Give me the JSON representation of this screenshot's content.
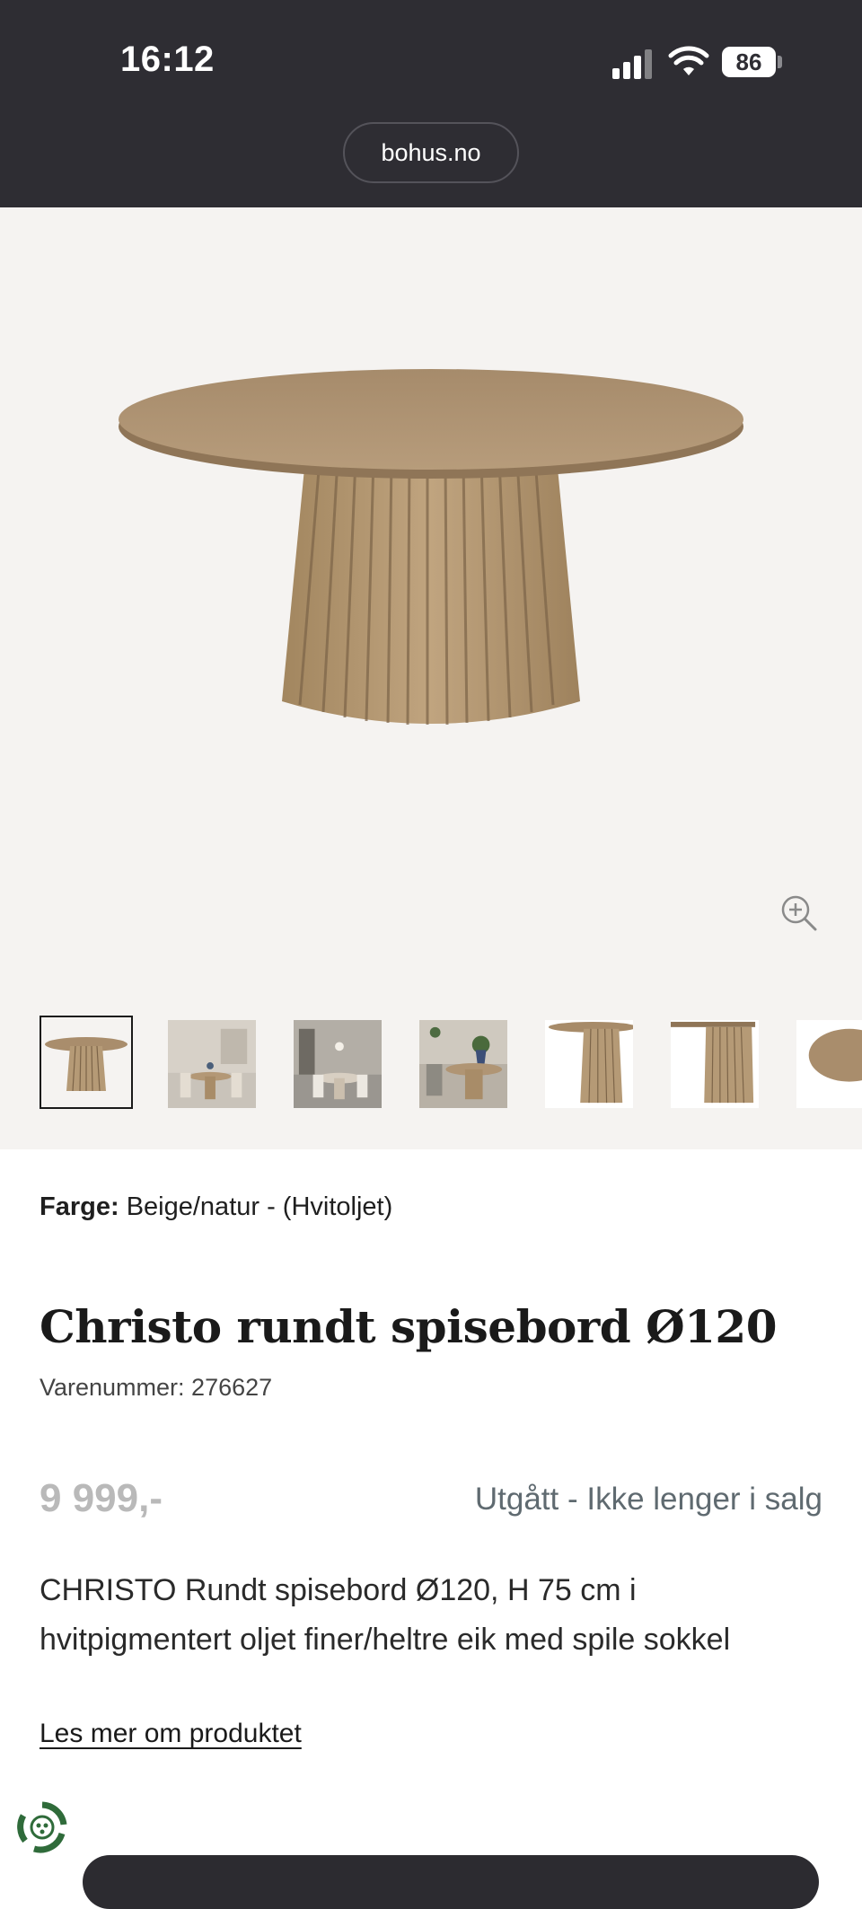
{
  "status_bar": {
    "time": "16:12",
    "battery": "86",
    "icons": [
      "cellular-signal-icon",
      "wifi-icon",
      "battery-icon"
    ]
  },
  "browser": {
    "url": "bohus.no"
  },
  "gallery": {
    "zoom_icon": "zoom-in-icon",
    "thumbnails_count_visible": 7,
    "selected_index": 0
  },
  "product": {
    "color_label": "Farge:",
    "color_value": "Beige/natur - (Hvitoljet)",
    "title": "Christo rundt spisebord Ø120",
    "sku": "Varenummer: 276627",
    "price": "9 999,-",
    "availability": "Utgått - Ikke lenger i salg",
    "description": "CHRISTO Rundt spisebord Ø120, H 75 cm i hvitpigmentert oljet finer/heltre eik med spile sokkel",
    "read_more": "Les mer om produktet"
  },
  "colors": {
    "chrome": "#2e2d33",
    "gallery_bg": "#f5f3f1",
    "wood": "#b49a78",
    "price_muted": "#b9b9b9",
    "status_text": "#5f6a70",
    "eco_badge": "#2f6b3a"
  }
}
